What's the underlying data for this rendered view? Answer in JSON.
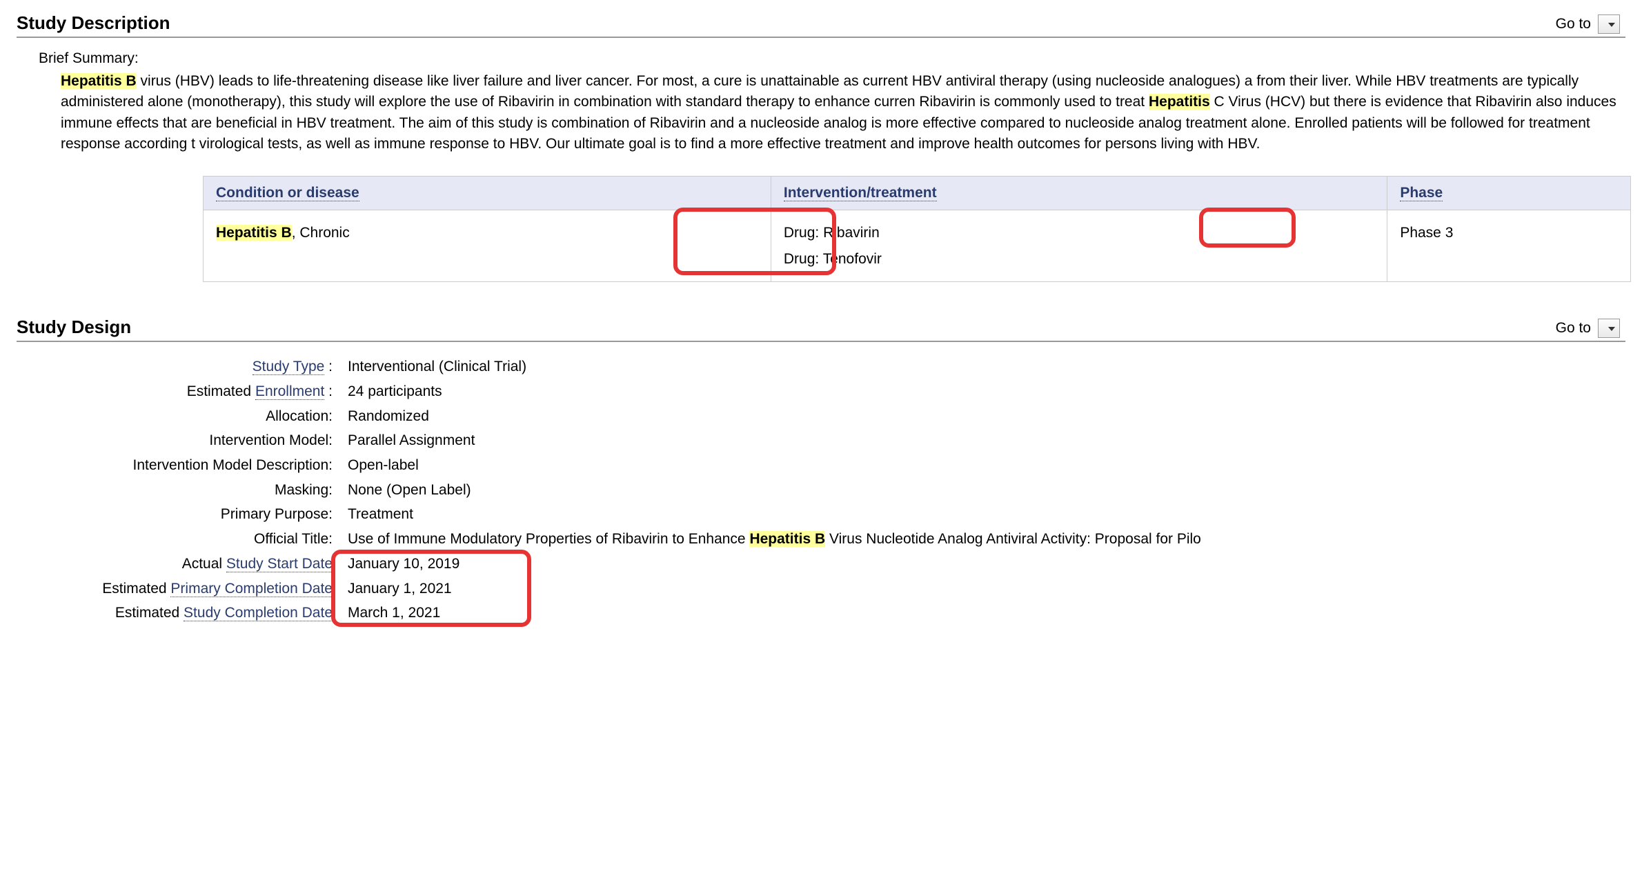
{
  "sections": {
    "description_title": "Study Description",
    "design_title": "Study Design",
    "goto_label": "Go to"
  },
  "brief": {
    "label": "Brief Summary:",
    "hl1": "Hepatitis B",
    "t1": " virus (HBV) leads to life-threatening disease like liver failure and liver cancer. For most, a cure is unattainable as current HBV antiviral therapy (using nucleoside analogues) a from their liver. While HBV treatments are typically administered alone (monotherapy), this study will explore the use of Ribavirin in combination with standard therapy to enhance curren Ribavirin is commonly used to treat ",
    "hl2": "Hepatitis",
    "t2": " C Virus (HCV) but there is evidence that Ribavirin also induces immune effects that are beneficial in HBV treatment. The aim of this study is combination of Ribavirin and a nucleoside analog is more effective compared to nucleoside analog treatment alone. Enrolled patients will be followed for treatment response according t virological tests, as well as immune response to HBV. Our ultimate goal is to find a more effective treatment and improve health outcomes for persons living with HBV."
  },
  "table": {
    "headers": {
      "condition": "Condition or disease",
      "intervention": "Intervention/treatment",
      "phase": "Phase"
    },
    "row": {
      "cond_hl": "Hepatitis B",
      "cond_rest": ", Chronic",
      "int1": "Drug: Ribavirin",
      "int2": "Drug: Tenofovir",
      "phase": "Phase 3"
    }
  },
  "design": {
    "rows": [
      {
        "label_pre": "",
        "label_link": "Study Type",
        "label_post": " :",
        "value": "Interventional  (Clinical Trial)"
      },
      {
        "label_pre": "Estimated ",
        "label_link": "Enrollment",
        "label_post": " :",
        "value": "24 participants"
      },
      {
        "label_pre": "",
        "label_link": "",
        "label_post": "Allocation:",
        "value": "Randomized"
      },
      {
        "label_pre": "",
        "label_link": "",
        "label_post": "Intervention Model:",
        "value": "Parallel Assignment"
      },
      {
        "label_pre": "",
        "label_link": "",
        "label_post": "Intervention Model Description:",
        "value": "Open-label"
      },
      {
        "label_pre": "",
        "label_link": "",
        "label_post": "Masking:",
        "value": "None (Open Label)"
      },
      {
        "label_pre": "",
        "label_link": "",
        "label_post": "Primary Purpose:",
        "value": "Treatment"
      },
      {
        "label_pre": "",
        "label_link": "",
        "label_post": "Official Title:",
        "value_pre": "Use of Immune Modulatory Properties of Ribavirin to Enhance ",
        "value_hl": "Hepatitis B",
        "value_post": " Virus Nucleotide Analog Antiviral Activity: Proposal for Pilo"
      },
      {
        "label_pre": "Actual ",
        "label_link": "Study Start Date",
        "label_post": "",
        "value": "January 10, 2019"
      },
      {
        "label_pre": "Estimated ",
        "label_link": "Primary Completion Date",
        "label_post": "",
        "value": "January 1, 2021"
      },
      {
        "label_pre": "Estimated ",
        "label_link": "Study Completion Date",
        "label_post": "",
        "value": "March 1, 2021"
      }
    ]
  }
}
